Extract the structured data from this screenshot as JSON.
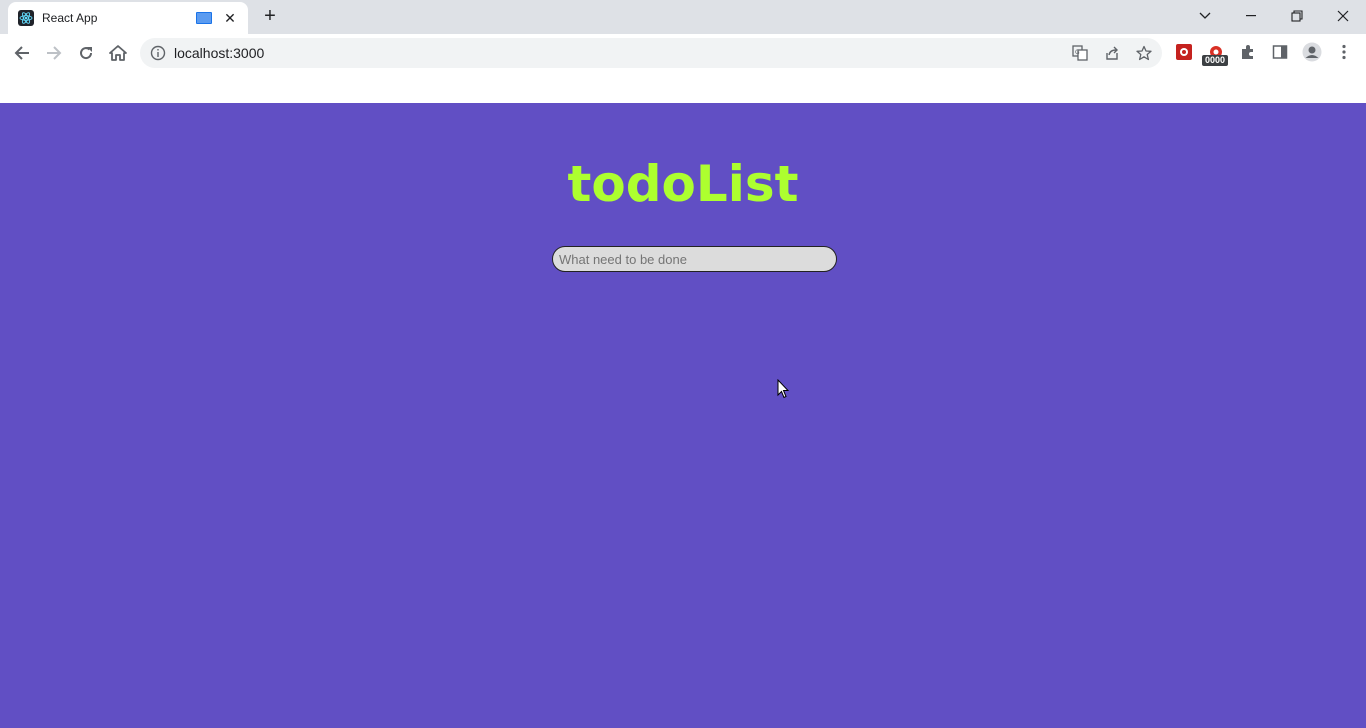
{
  "browser": {
    "tab": {
      "title": "React App"
    },
    "toolbar": {
      "url": "localhost:3000"
    },
    "extension_badge": "0000"
  },
  "app": {
    "title": "todoList",
    "input": {
      "placeholder": "What need to be done",
      "value": ""
    }
  },
  "colors": {
    "page_background": "#614fc4",
    "title": "#adff2f",
    "input_background": "#dcdcdc"
  },
  "icons": {
    "tab": [
      "react-icon",
      "media-icon",
      "close-icon",
      "plus-icon"
    ],
    "window": [
      "chevron-down-icon",
      "minimize-icon",
      "restore-icon",
      "close-icon"
    ],
    "toolbar": [
      "back-icon",
      "forward-icon",
      "reload-icon",
      "home-icon",
      "info-icon",
      "translate-icon",
      "share-icon",
      "star-icon",
      "extension-icon",
      "puzzle-icon",
      "sidepanel-icon",
      "profile-icon",
      "kebab-menu-icon"
    ]
  }
}
